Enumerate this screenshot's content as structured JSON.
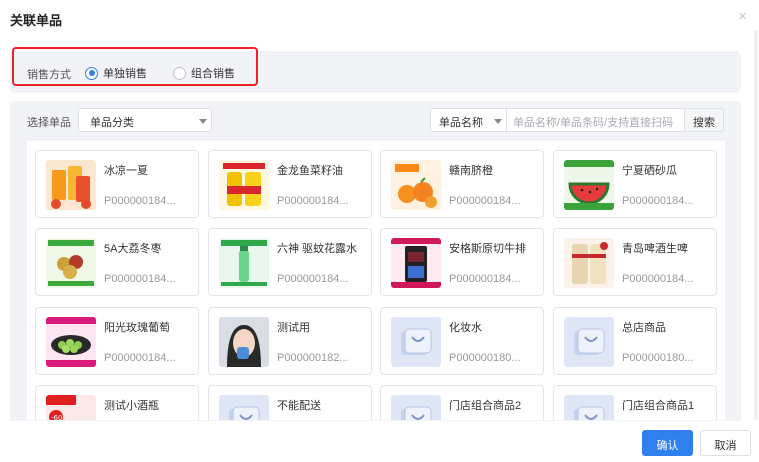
{
  "dialog": {
    "title": "关联单品",
    "close_icon": "×"
  },
  "sale_mode": {
    "label": "销售方式",
    "options": [
      {
        "label": "单独销售",
        "checked": true
      },
      {
        "label": "组合销售",
        "checked": false
      }
    ]
  },
  "filters": {
    "select_label": "选择单品",
    "category_value": "单品分类",
    "field_value": "单品名称",
    "search_placeholder": "单品名称/单品条码/支持直接扫码",
    "search_button": "搜索"
  },
  "products": [
    {
      "name": "冰凉一夏",
      "code": "P000000184...",
      "image": "drink-cups"
    },
    {
      "name": "金龙鱼菜籽油",
      "code": "P000000184...",
      "image": "oil-bottle"
    },
    {
      "name": "赣南脐橙",
      "code": "P000000184...",
      "image": "oranges"
    },
    {
      "name": "宁夏硒砂瓜",
      "code": "P000000184...",
      "image": "watermelon"
    },
    {
      "name": "5A大荔冬枣",
      "code": "P000000184...",
      "image": "jujube"
    },
    {
      "name": "六神 驱蚊花露水",
      "code": "P000000184...",
      "image": "spray-bottle"
    },
    {
      "name": "安格斯原切牛排",
      "code": "P000000184...",
      "image": "steak-pack"
    },
    {
      "name": "青岛啤酒生啤",
      "code": "P000000184...",
      "image": "beer-can"
    },
    {
      "name": "阳光玫瑰葡萄",
      "code": "P000000184...",
      "image": "grapes"
    },
    {
      "name": "测试用",
      "code": "P000000182...",
      "image": "portrait"
    },
    {
      "name": "化妆水",
      "code": "P000000180...",
      "image": "placeholder-bag"
    },
    {
      "name": "总店商品",
      "code": "P000000180...",
      "image": "placeholder-bag"
    },
    {
      "name": "测试小酒瓶",
      "code": "",
      "image": "promo-red"
    },
    {
      "name": "不能配送",
      "code": "",
      "image": "placeholder-bag"
    },
    {
      "name": "门店组合商品2",
      "code": "",
      "image": "placeholder-bag"
    },
    {
      "name": "门店组合商品1",
      "code": "",
      "image": "placeholder-bag"
    }
  ],
  "footer": {
    "confirm": "确认",
    "cancel": "取消"
  },
  "colors": {
    "primary": "#2f80ed",
    "highlight_border": "#e5252c",
    "panel_bg": "#f2f3f7"
  }
}
